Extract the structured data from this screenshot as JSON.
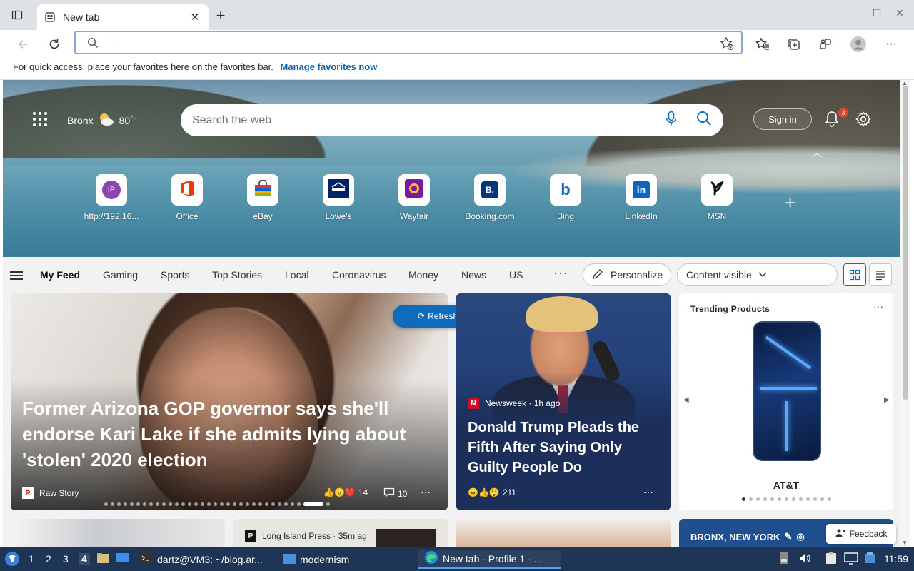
{
  "browser": {
    "tab_title": "New tab",
    "new_tab_symbol": "+",
    "address_value": "",
    "favorites_bar": {
      "message": "For quick access, place your favorites here on the favorites bar.",
      "link": "Manage favorites now"
    }
  },
  "hero": {
    "location": "Bronx",
    "temperature": "80",
    "temp_unit": "°F",
    "search_placeholder": "Search the web",
    "sign_in": "Sign in",
    "notification_count": "3",
    "tiles": [
      {
        "label": "http://192.16...",
        "icon": "ip-avatar-icon",
        "glyph": "IP"
      },
      {
        "label": "Office",
        "icon": "office-icon"
      },
      {
        "label": "eBay",
        "icon": "ebay-icon"
      },
      {
        "label": "Lowe's",
        "icon": "lowes-icon"
      },
      {
        "label": "Wayfair",
        "icon": "wayfair-icon"
      },
      {
        "label": "Booking.com",
        "icon": "booking-icon",
        "glyph": "B."
      },
      {
        "label": "Bing",
        "icon": "bing-icon",
        "glyph": "b"
      },
      {
        "label": "LinkedIn",
        "icon": "linkedin-icon",
        "glyph": "in"
      },
      {
        "label": "MSN",
        "icon": "msn-icon"
      }
    ],
    "add_tile_symbol": "+"
  },
  "feed_nav": {
    "items": [
      "My Feed",
      "Gaming",
      "Sports",
      "Top Stories",
      "Local",
      "Coronavirus",
      "Money",
      "News",
      "US"
    ],
    "more": "···",
    "personalize": "Personalize",
    "content_visibility": "Content visible"
  },
  "cards": {
    "refresh": "Refresh stories",
    "main_story": {
      "headline": "Former Arizona GOP governor says she'll endorse Kari Lake if she admits lying about 'stolen' 2020 election",
      "source": "Raw Story",
      "source_glyph": "R",
      "reactions": "14",
      "comments": "10"
    },
    "second_story": {
      "source": "Newsweek",
      "source_glyph": "N",
      "time": "1h ago",
      "headline": "Donald Trump Pleads the Fifth After Saying Only Guilty People Do",
      "reactions": "211"
    },
    "trending": {
      "title": "Trending Products",
      "product": "AT&T",
      "dots": 13,
      "active_dot": 0
    },
    "mini": [
      {
        "source": "Long Island Press",
        "time": "35m ag"
      },
      {
        "location": "BRONX, NEW YORK"
      }
    ],
    "feedback": "Feedback"
  },
  "taskbar": {
    "workspaces": [
      "1",
      "2",
      "3",
      "4"
    ],
    "active_workspace": "4",
    "terminal": "dartz@VM3: ~/blog.ar...",
    "folder": "modernism",
    "browser": "New tab - Profile 1 - ...",
    "clock": "11:59"
  },
  "colors": {
    "accent": "#0f6cbd",
    "taskbar": "#1f3556",
    "link": "#0f63b3"
  }
}
